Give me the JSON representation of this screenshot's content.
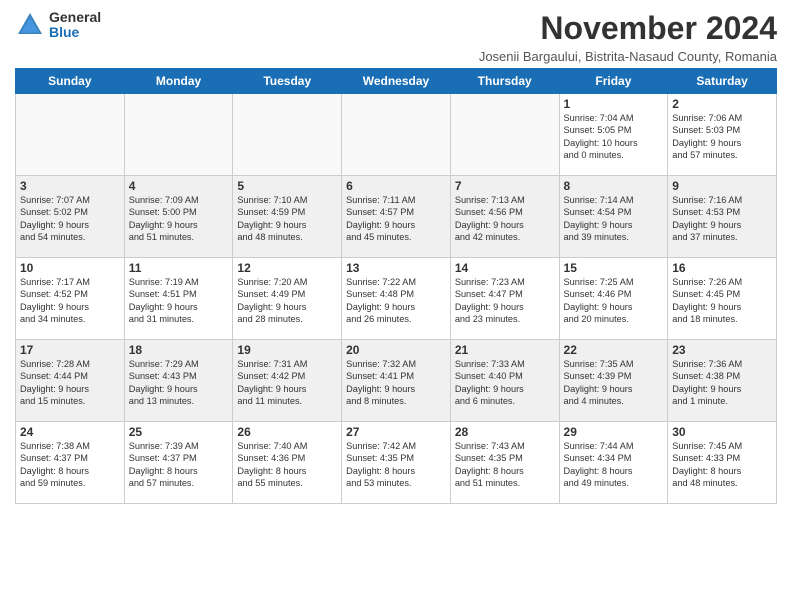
{
  "logo": {
    "general": "General",
    "blue": "Blue"
  },
  "title": "November 2024",
  "location": "Josenii Bargaului, Bistrita-Nasaud County, Romania",
  "headers": [
    "Sunday",
    "Monday",
    "Tuesday",
    "Wednesday",
    "Thursday",
    "Friday",
    "Saturday"
  ],
  "rows": [
    [
      {
        "num": "",
        "detail": "",
        "empty": true
      },
      {
        "num": "",
        "detail": "",
        "empty": true
      },
      {
        "num": "",
        "detail": "",
        "empty": true
      },
      {
        "num": "",
        "detail": "",
        "empty": true
      },
      {
        "num": "",
        "detail": "",
        "empty": true
      },
      {
        "num": "1",
        "detail": "Sunrise: 7:04 AM\nSunset: 5:05 PM\nDaylight: 10 hours\nand 0 minutes.",
        "empty": false
      },
      {
        "num": "2",
        "detail": "Sunrise: 7:06 AM\nSunset: 5:03 PM\nDaylight: 9 hours\nand 57 minutes.",
        "empty": false
      }
    ],
    [
      {
        "num": "3",
        "detail": "Sunrise: 7:07 AM\nSunset: 5:02 PM\nDaylight: 9 hours\nand 54 minutes.",
        "empty": false
      },
      {
        "num": "4",
        "detail": "Sunrise: 7:09 AM\nSunset: 5:00 PM\nDaylight: 9 hours\nand 51 minutes.",
        "empty": false
      },
      {
        "num": "5",
        "detail": "Sunrise: 7:10 AM\nSunset: 4:59 PM\nDaylight: 9 hours\nand 48 minutes.",
        "empty": false
      },
      {
        "num": "6",
        "detail": "Sunrise: 7:11 AM\nSunset: 4:57 PM\nDaylight: 9 hours\nand 45 minutes.",
        "empty": false
      },
      {
        "num": "7",
        "detail": "Sunrise: 7:13 AM\nSunset: 4:56 PM\nDaylight: 9 hours\nand 42 minutes.",
        "empty": false
      },
      {
        "num": "8",
        "detail": "Sunrise: 7:14 AM\nSunset: 4:54 PM\nDaylight: 9 hours\nand 39 minutes.",
        "empty": false
      },
      {
        "num": "9",
        "detail": "Sunrise: 7:16 AM\nSunset: 4:53 PM\nDaylight: 9 hours\nand 37 minutes.",
        "empty": false
      }
    ],
    [
      {
        "num": "10",
        "detail": "Sunrise: 7:17 AM\nSunset: 4:52 PM\nDaylight: 9 hours\nand 34 minutes.",
        "empty": false
      },
      {
        "num": "11",
        "detail": "Sunrise: 7:19 AM\nSunset: 4:51 PM\nDaylight: 9 hours\nand 31 minutes.",
        "empty": false
      },
      {
        "num": "12",
        "detail": "Sunrise: 7:20 AM\nSunset: 4:49 PM\nDaylight: 9 hours\nand 28 minutes.",
        "empty": false
      },
      {
        "num": "13",
        "detail": "Sunrise: 7:22 AM\nSunset: 4:48 PM\nDaylight: 9 hours\nand 26 minutes.",
        "empty": false
      },
      {
        "num": "14",
        "detail": "Sunrise: 7:23 AM\nSunset: 4:47 PM\nDaylight: 9 hours\nand 23 minutes.",
        "empty": false
      },
      {
        "num": "15",
        "detail": "Sunrise: 7:25 AM\nSunset: 4:46 PM\nDaylight: 9 hours\nand 20 minutes.",
        "empty": false
      },
      {
        "num": "16",
        "detail": "Sunrise: 7:26 AM\nSunset: 4:45 PM\nDaylight: 9 hours\nand 18 minutes.",
        "empty": false
      }
    ],
    [
      {
        "num": "17",
        "detail": "Sunrise: 7:28 AM\nSunset: 4:44 PM\nDaylight: 9 hours\nand 15 minutes.",
        "empty": false
      },
      {
        "num": "18",
        "detail": "Sunrise: 7:29 AM\nSunset: 4:43 PM\nDaylight: 9 hours\nand 13 minutes.",
        "empty": false
      },
      {
        "num": "19",
        "detail": "Sunrise: 7:31 AM\nSunset: 4:42 PM\nDaylight: 9 hours\nand 11 minutes.",
        "empty": false
      },
      {
        "num": "20",
        "detail": "Sunrise: 7:32 AM\nSunset: 4:41 PM\nDaylight: 9 hours\nand 8 minutes.",
        "empty": false
      },
      {
        "num": "21",
        "detail": "Sunrise: 7:33 AM\nSunset: 4:40 PM\nDaylight: 9 hours\nand 6 minutes.",
        "empty": false
      },
      {
        "num": "22",
        "detail": "Sunrise: 7:35 AM\nSunset: 4:39 PM\nDaylight: 9 hours\nand 4 minutes.",
        "empty": false
      },
      {
        "num": "23",
        "detail": "Sunrise: 7:36 AM\nSunset: 4:38 PM\nDaylight: 9 hours\nand 1 minute.",
        "empty": false
      }
    ],
    [
      {
        "num": "24",
        "detail": "Sunrise: 7:38 AM\nSunset: 4:37 PM\nDaylight: 8 hours\nand 59 minutes.",
        "empty": false
      },
      {
        "num": "25",
        "detail": "Sunrise: 7:39 AM\nSunset: 4:37 PM\nDaylight: 8 hours\nand 57 minutes.",
        "empty": false
      },
      {
        "num": "26",
        "detail": "Sunrise: 7:40 AM\nSunset: 4:36 PM\nDaylight: 8 hours\nand 55 minutes.",
        "empty": false
      },
      {
        "num": "27",
        "detail": "Sunrise: 7:42 AM\nSunset: 4:35 PM\nDaylight: 8 hours\nand 53 minutes.",
        "empty": false
      },
      {
        "num": "28",
        "detail": "Sunrise: 7:43 AM\nSunset: 4:35 PM\nDaylight: 8 hours\nand 51 minutes.",
        "empty": false
      },
      {
        "num": "29",
        "detail": "Sunrise: 7:44 AM\nSunset: 4:34 PM\nDaylight: 8 hours\nand 49 minutes.",
        "empty": false
      },
      {
        "num": "30",
        "detail": "Sunrise: 7:45 AM\nSunset: 4:33 PM\nDaylight: 8 hours\nand 48 minutes.",
        "empty": false
      }
    ]
  ]
}
